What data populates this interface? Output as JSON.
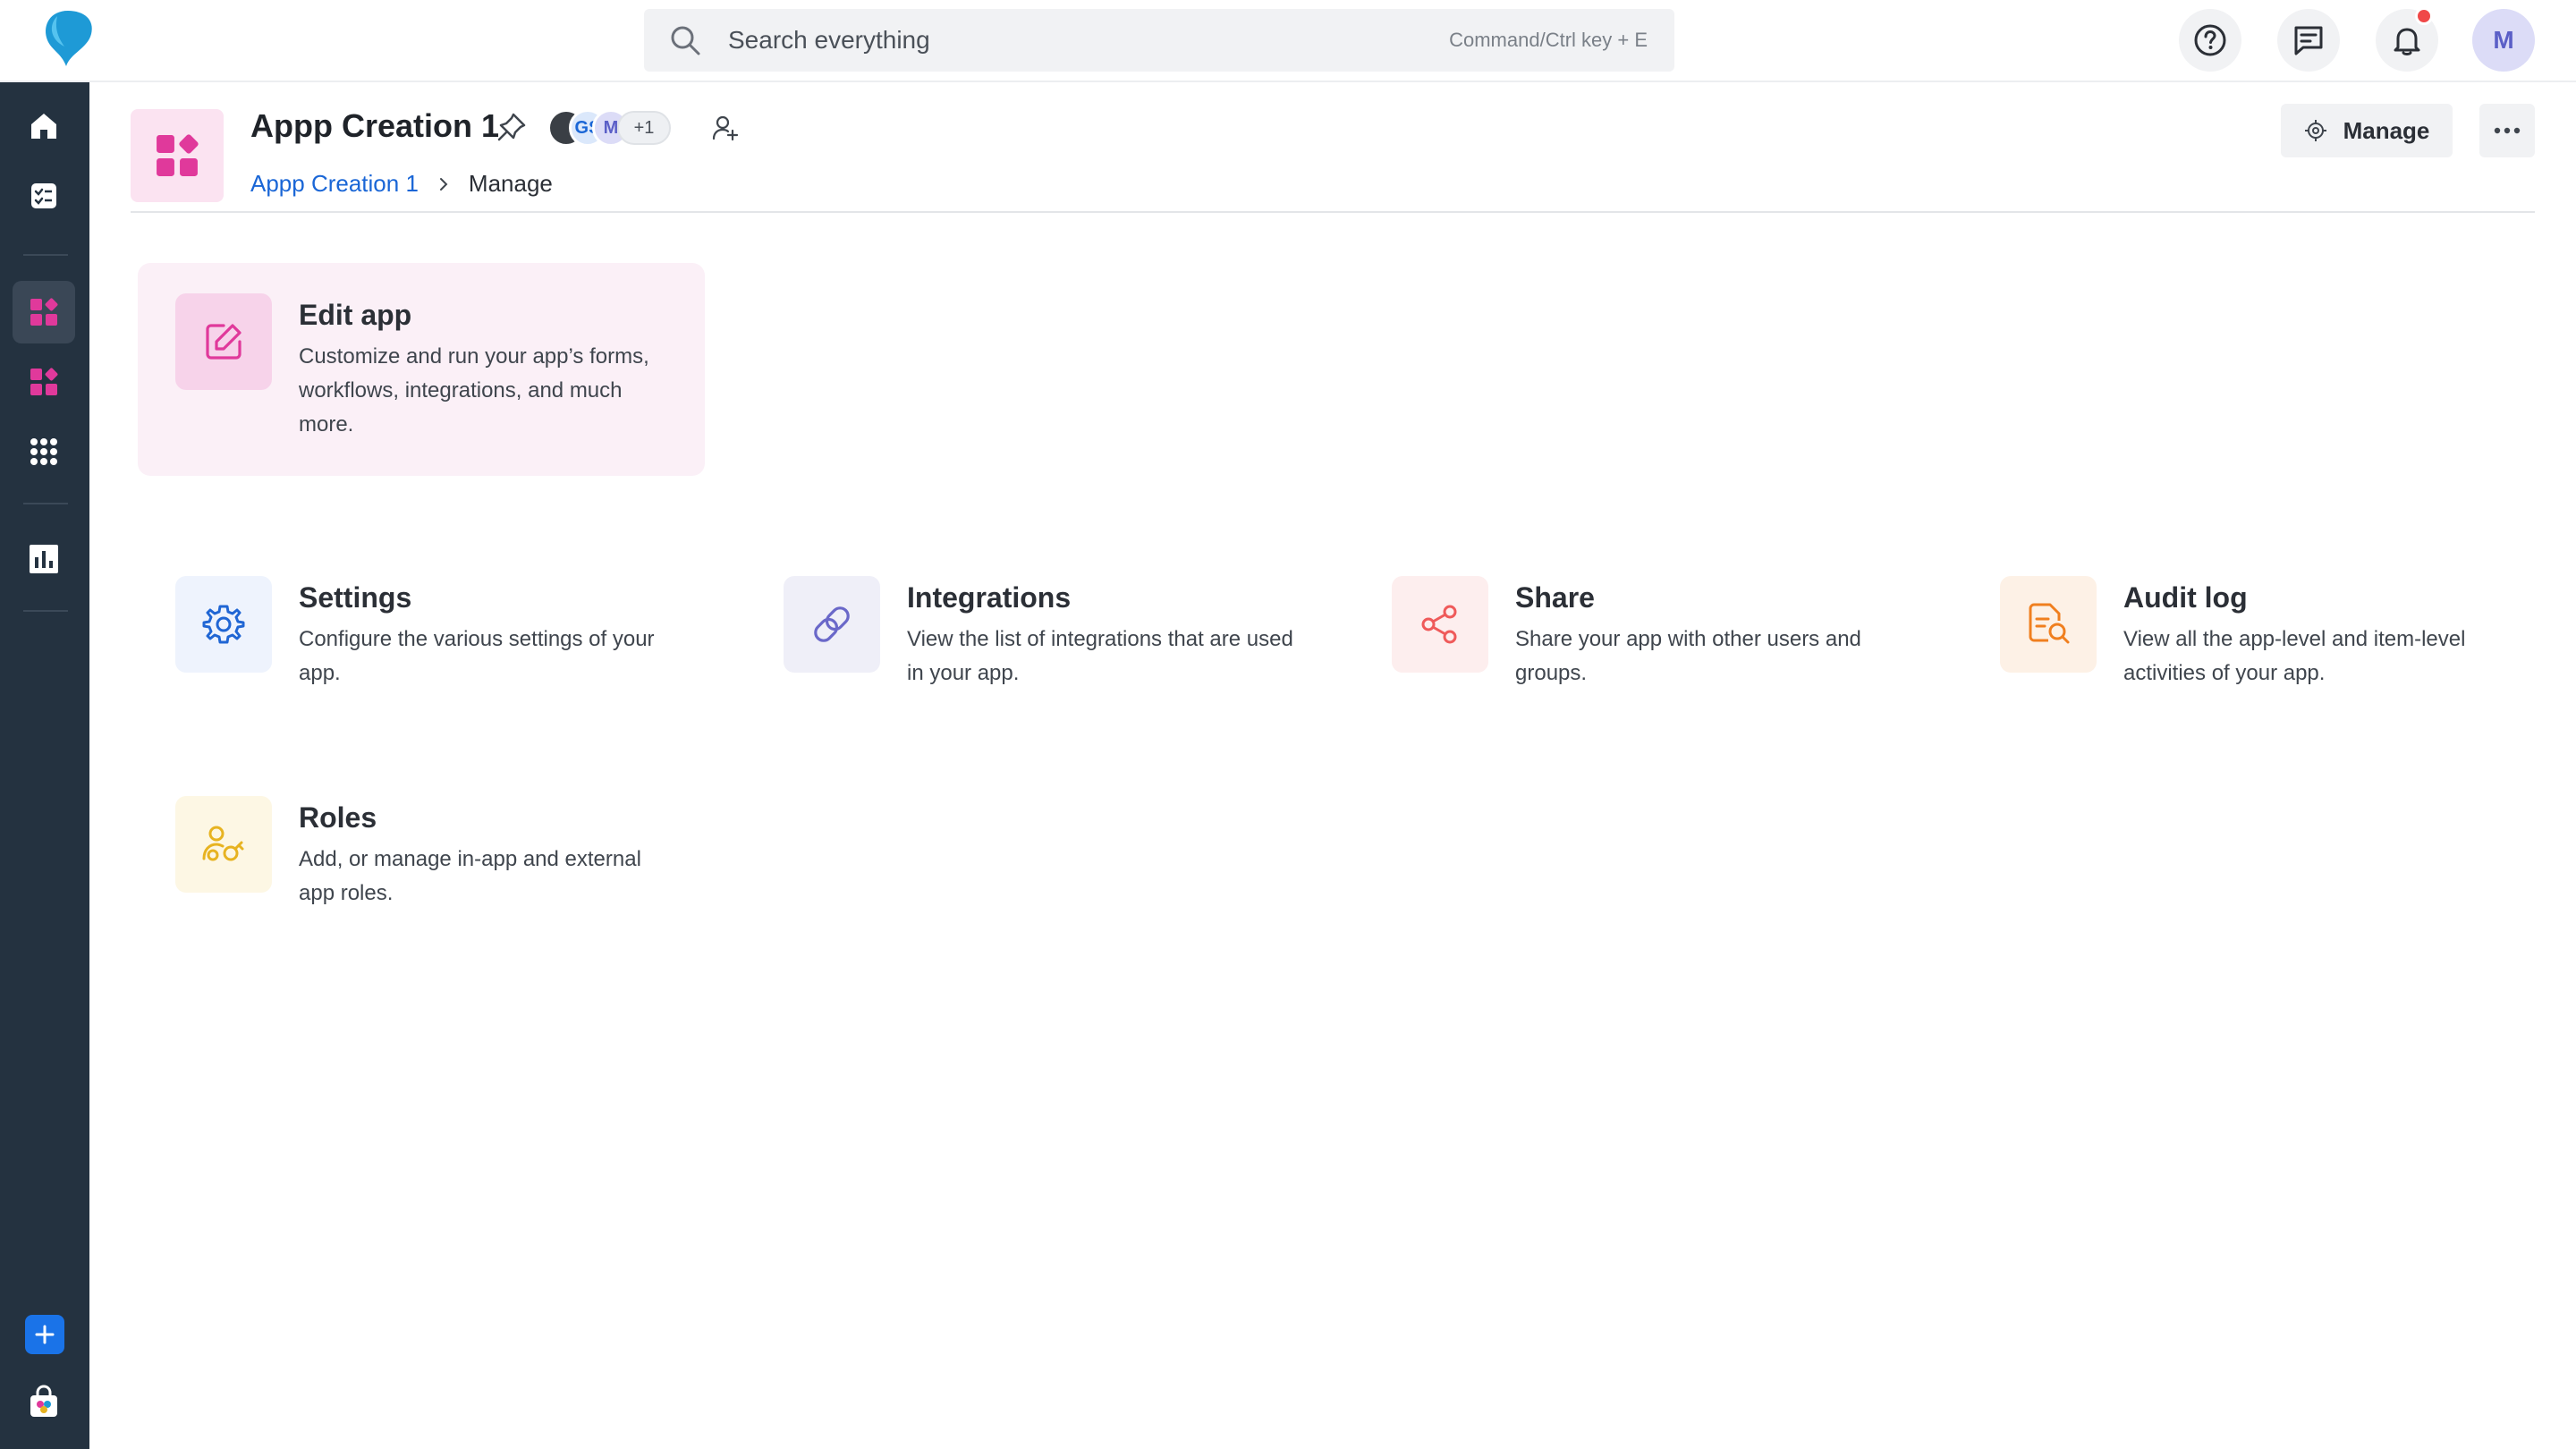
{
  "topbar": {
    "search_placeholder": "Search everything",
    "search_hint": "Command/Ctrl key + E",
    "user_initial": "M"
  },
  "header": {
    "app_title": "Appp Creation 1",
    "members": [
      {
        "initial": ""
      },
      {
        "initial": "GS"
      },
      {
        "initial": "M"
      }
    ],
    "members_more": "+1",
    "breadcrumb": {
      "root": "Appp Creation 1",
      "current": "Manage"
    },
    "manage_label": "Manage"
  },
  "cards": {
    "edit_app": {
      "title": "Edit app",
      "desc": "Customize and run your app’s forms, workflows, integrations, and much more."
    },
    "settings": {
      "title": "Settings",
      "desc": "Configure the various settings of your app."
    },
    "integrations": {
      "title": "Integrations",
      "desc": "View the list of integrations that are used in your app."
    },
    "share": {
      "title": "Share",
      "desc": "Share your app with other users and groups."
    },
    "audit_log": {
      "title": "Audit log",
      "desc": "View all the app-level and item-level activities of your app."
    },
    "roles": {
      "title": "Roles",
      "desc": "Add, or manage in-app and external app roles."
    }
  },
  "colors": {
    "rail": "#243240",
    "accent_pink": "#e0399b",
    "link_blue": "#1a66d6",
    "integrations_purple": "#6a68c9",
    "share_red": "#ef5a5a",
    "audit_orange": "#f07f1f",
    "roles_yellow": "#e7b321"
  }
}
